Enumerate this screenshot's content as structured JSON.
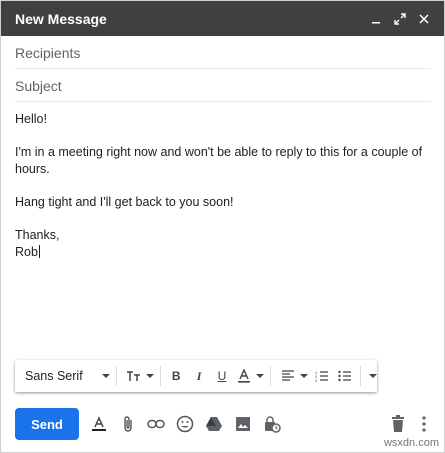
{
  "window": {
    "title": "New Message",
    "controls": [
      "minimize-icon",
      "expand-icon",
      "close-icon"
    ]
  },
  "fields": {
    "recipients_placeholder": "Recipients",
    "subject_placeholder": "Subject"
  },
  "body": {
    "line1": "Hello!",
    "line2": "I'm in a meeting right now and won't be able to reply to this for a couple of hours.",
    "line3": "Hang tight and I'll get back to you soon!",
    "line4": "Thanks,",
    "line5": "Rob"
  },
  "format_toolbar": {
    "font": "Sans Serif",
    "icons": [
      "font-size-icon",
      "bold-icon",
      "italic-icon",
      "underline-icon",
      "text-color-icon",
      "align-icon",
      "numbered-list-icon",
      "bulleted-list-icon",
      "more-formatting-icon"
    ]
  },
  "bottom_toolbar": {
    "send_label": "Send",
    "icons": [
      "formatting-options-icon",
      "attach-icon",
      "link-icon",
      "emoji-icon",
      "drive-icon",
      "photo-icon",
      "confidential-mode-icon",
      "trash-icon",
      "more-options-icon"
    ]
  },
  "watermark": "wsxdn.com",
  "colors": {
    "titlebar": "#404040",
    "send": "#1a73e8"
  }
}
